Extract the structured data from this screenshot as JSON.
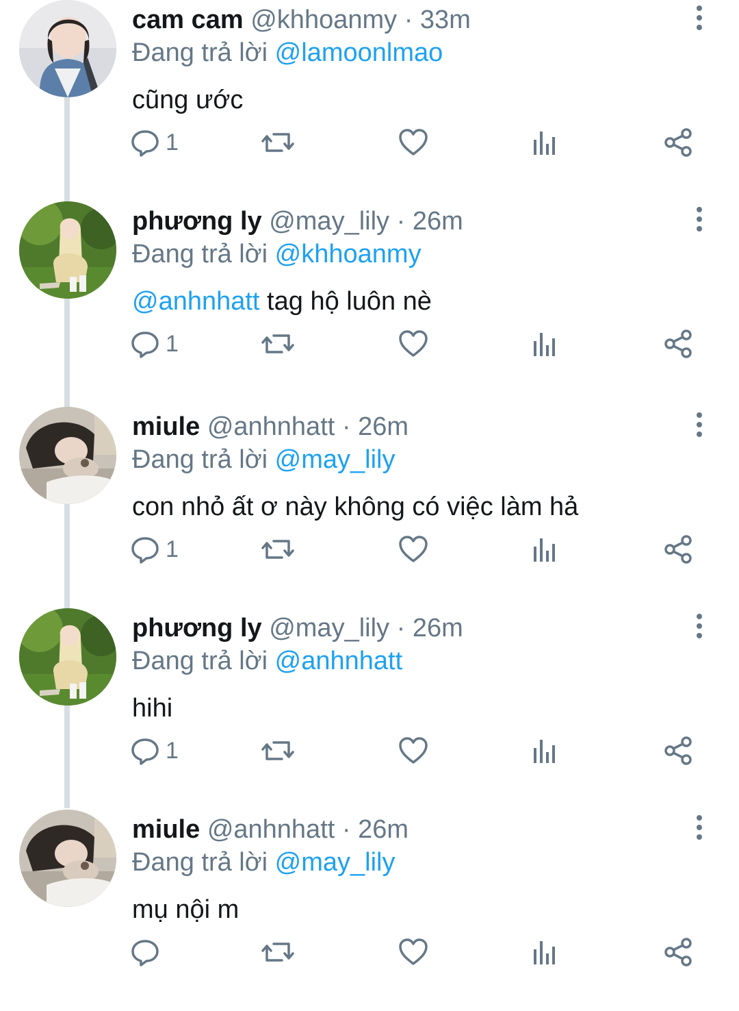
{
  "tweets": [
    {
      "name": "cam cam",
      "handle": "@khhoanmy",
      "separator": "·",
      "time": "33m",
      "reply_prefix": "Đang trả lời",
      "reply_to": "@lamoonlmao",
      "body_mention": "",
      "body_text": "cũng ước",
      "reply_count": "1",
      "avatar_icon": "user-avatar"
    },
    {
      "name": "phương ly",
      "handle": "@may_lily",
      "separator": "·",
      "time": "26m",
      "reply_prefix": "Đang trả lời",
      "reply_to": "@khhoanmy",
      "body_mention": "@anhnhatt",
      "body_text": " tag hộ luôn nè",
      "reply_count": "1",
      "avatar_icon": "user-avatar"
    },
    {
      "name": "miule",
      "handle": "@anhnhatt",
      "separator": "·",
      "time": "26m",
      "reply_prefix": "Đang trả lời",
      "reply_to": "@may_lily",
      "body_mention": "",
      "body_text": "con nhỏ ất ơ này không có việc làm hả",
      "reply_count": "1",
      "avatar_icon": "user-avatar"
    },
    {
      "name": "phương ly",
      "handle": "@may_lily",
      "separator": "·",
      "time": "26m",
      "reply_prefix": "Đang trả lời",
      "reply_to": "@anhnhatt",
      "body_mention": "",
      "body_text": "hihi",
      "reply_count": "1",
      "avatar_icon": "user-avatar"
    },
    {
      "name": "miule",
      "handle": "@anhnhatt",
      "separator": "·",
      "time": "26m",
      "reply_prefix": "Đang trả lời",
      "reply_to": "@may_lily",
      "body_mention": "",
      "body_text": "mụ nội m",
      "reply_count": "",
      "avatar_icon": "user-avatar"
    }
  ],
  "icons": {
    "reply": "reply-icon",
    "retweet": "retweet-icon",
    "like": "heart-icon",
    "stats": "stats-icon",
    "share": "share-icon",
    "more": "more-vertical-icon"
  },
  "colors": {
    "text": "#14171a",
    "muted": "#657786",
    "link": "#1da1f2",
    "icon": "#657786",
    "thread_line": "#d7dde3"
  }
}
